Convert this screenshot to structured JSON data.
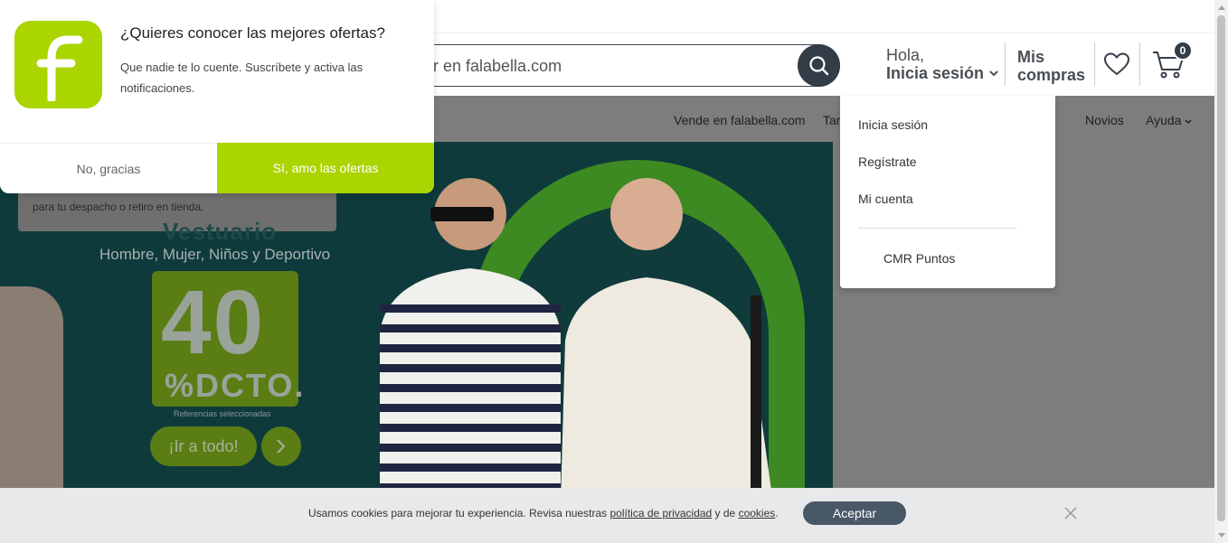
{
  "header": {
    "search_placeholder": "r en falabella.com",
    "greeting": "Hola,",
    "login_label": "Inicia sesión",
    "my_purchases_line1": "Mis",
    "my_purchases_line2": "compras",
    "cart_count": "0"
  },
  "nav": {
    "items": [
      "Vende en falabella.com",
      "Tar",
      "Novios",
      "Ayuda"
    ]
  },
  "banner": {
    "hint_text": "para tu despacho o retiro en tienda.",
    "heading": "Vestuario",
    "categories": "Hombre, Mujer, Niños y Deportivo",
    "discount_number": "40",
    "discount_label": "%DCTO.",
    "references": "Referencias seleccionadas",
    "cta": "¡Ir a todo!"
  },
  "notification": {
    "title": "¿Quieres conocer las mejores ofertas?",
    "body": "Que nadie te lo cuente. Suscríbete y activa las notificaciones.",
    "decline": "No, gracias",
    "accept": "Sí, amo las ofertas",
    "brand_color": "#aad500"
  },
  "account_menu": {
    "items": [
      "Inicia sesión",
      "Regístrate",
      "Mi cuenta"
    ],
    "points": "CMR Puntos"
  },
  "cookie_bar": {
    "text_before": "Usamos cookies para mejorar tu experiencia. Revisa nuestras ",
    "privacy_link": "política de privacidad",
    "text_middle": " y de ",
    "cookies_link": "cookies",
    "text_after": ".",
    "accept": "Aceptar"
  },
  "colors": {
    "accent": "#aad500",
    "dark": "#333d48",
    "overlay": "#7d7d7d"
  }
}
